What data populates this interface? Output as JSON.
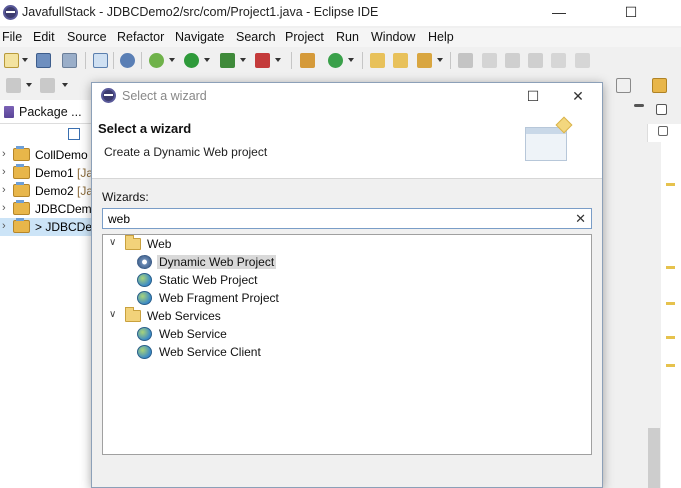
{
  "window": {
    "title": "JavafullStack - JDBCDemo2/src/com/Project1.java - Eclipse IDE",
    "minimize": "—",
    "maximize": "☐",
    "close": "✕"
  },
  "menu": [
    "File",
    "Edit",
    "Source",
    "Refactor",
    "Navigate",
    "Search",
    "Project",
    "Run",
    "Window",
    "Help"
  ],
  "package_explorer": {
    "tab_label": "Package ...",
    "tab_close": "✕",
    "items": [
      {
        "name": "CollDemo",
        "sub": ""
      },
      {
        "name": "Demo1",
        "sub": " [Jav"
      },
      {
        "name": "Demo2",
        "sub": " [Jav"
      },
      {
        "name": "JDBCDemo",
        "sub": ""
      },
      {
        "name": "> JDBCDem",
        "sub": ""
      }
    ]
  },
  "dialog": {
    "title": "Select a wizard",
    "maximize": "☐",
    "close": "✕",
    "header_title": "Select a wizard",
    "header_desc": "Create a Dynamic Web project",
    "wizards_label": "Wizards:",
    "search_value": "web",
    "clear_glyph": "✕",
    "tree": [
      {
        "label": "Web",
        "children": [
          "Dynamic Web Project",
          "Static Web Project",
          "Web Fragment Project"
        ]
      },
      {
        "label": "Web Services",
        "children": [
          "Web Service",
          "Web Service Client"
        ]
      }
    ],
    "selected": "Dynamic Web Project"
  },
  "colors": {
    "selection": "#d9d9d9",
    "search_border": "#7a9dc7",
    "accent_yellow": "#e6c24d"
  }
}
